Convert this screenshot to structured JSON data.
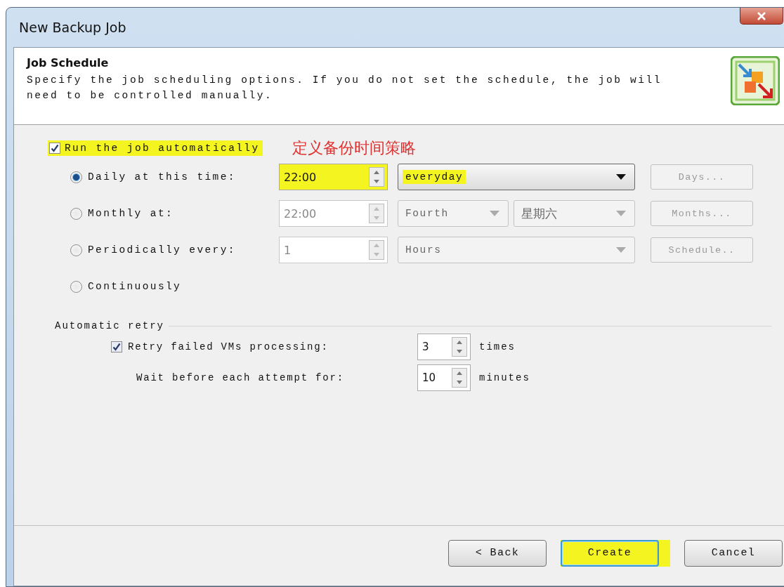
{
  "window": {
    "title": "New Backup Job"
  },
  "header": {
    "title": "Job Schedule",
    "description": "Specify the job scheduling options. If you do not set the schedule, the job will need to be controlled manually."
  },
  "annotation": "定义备份时间策略",
  "run_automatically": {
    "label": "Run the job automatically",
    "checked": true,
    "highlighted": true
  },
  "schedule_options": [
    {
      "kind": "daily",
      "label": "Daily at this time:",
      "selected": true,
      "spinner": {
        "value": "22:00",
        "disabled": false,
        "highlighted": true
      },
      "dropdowns": [
        {
          "value": "everyday",
          "disabled": false,
          "highlighted": true
        }
      ],
      "button": {
        "label": "Days...",
        "disabled": true
      }
    },
    {
      "kind": "monthly",
      "label": "Monthly at:",
      "selected": false,
      "spinner": {
        "value": "22:00",
        "disabled": true,
        "highlighted": false
      },
      "dropdowns": [
        {
          "value": "Fourth",
          "disabled": true,
          "highlighted": false
        },
        {
          "value": "星期六",
          "disabled": true,
          "highlighted": false
        }
      ],
      "button": {
        "label": "Months...",
        "disabled": true
      }
    },
    {
      "kind": "periodic",
      "label": "Periodically every:",
      "selected": false,
      "spinner": {
        "value": "1",
        "disabled": true,
        "highlighted": false
      },
      "dropdowns": [
        {
          "value": "Hours",
          "disabled": true,
          "highlighted": false
        }
      ],
      "button": {
        "label": "Schedule..",
        "disabled": true
      }
    },
    {
      "kind": "continuous",
      "label": "Continuously",
      "selected": false
    }
  ],
  "retry": {
    "title": "Automatic retry",
    "rows": [
      {
        "kind": "checkbox",
        "label": "Retry failed VMs processing:",
        "checked": true,
        "value": "3",
        "unit": "times"
      },
      {
        "kind": "plain",
        "label": "Wait before each attempt for:",
        "value": "10",
        "unit": "minutes"
      }
    ]
  },
  "buttons": [
    {
      "label": "< Back",
      "default": false,
      "highlighted": false
    },
    {
      "label": "Create",
      "default": true,
      "highlighted": true
    },
    {
      "label": "Cancel",
      "default": false,
      "highlighted": false
    }
  ]
}
